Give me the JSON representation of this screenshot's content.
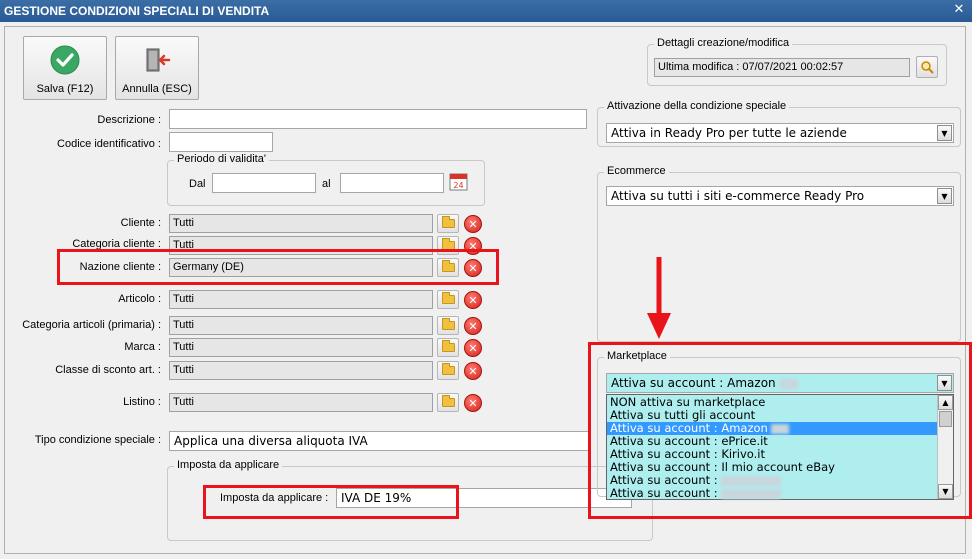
{
  "window": {
    "title": "GESTIONE CONDIZIONI SPECIALI DI VENDITA",
    "close_glyph": "✕"
  },
  "toolbar": {
    "save_label": "Salva (F12)",
    "cancel_label": "Annulla (ESC)"
  },
  "form": {
    "descrizione_label": "Descrizione :",
    "descrizione_value": "",
    "codice_label": "Codice identificativo :",
    "codice_value": "",
    "periodo_title": "Periodo di validita'",
    "dal_label": "Dal",
    "dal_value": "",
    "al_label": "al",
    "al_value": "",
    "calendar_day": "24",
    "cliente_label": "Cliente :",
    "cliente_value": "Tutti",
    "categoria_cliente_label": "Categoria cliente :",
    "categoria_cliente_value": "Tutti",
    "nazione_label": "Nazione cliente :",
    "nazione_value": "Germany (DE)",
    "articolo_label": "Articolo :",
    "articolo_value": "Tutti",
    "categoria_articoli_label": "Categoria articoli (primaria) :",
    "categoria_articoli_value": "Tutti",
    "marca_label": "Marca :",
    "marca_value": "Tutti",
    "classe_label": "Classe di sconto art. :",
    "classe_value": "Tutti",
    "listino_label": "Listino :",
    "listino_value": "Tutti",
    "tipo_label": "Tipo condizione speciale :",
    "tipo_value": "Applica una diversa aliquota IVA",
    "imposta_group_title": "Imposta da applicare",
    "imposta_label": "Imposta da applicare :",
    "imposta_value": "IVA DE 19%"
  },
  "right": {
    "dettagli_title": "Dettagli creazione/modifica",
    "ultima_modifica": "Ultima modifica : 07/07/2021  00:02:57",
    "attivazione_title": "Attivazione della condizione speciale",
    "attivazione_value": "Attiva in Ready Pro per tutte le aziende",
    "ecommerce_title": "Ecommerce",
    "ecommerce_value": "Attiva su tutti i siti e-commerce Ready Pro",
    "marketplace_title": "Marketplace",
    "marketplace_value": "Attiva su account : Amazon",
    "marketplace_options": [
      "NON attiva su marketplace",
      "Attiva su tutti gli account",
      "Attiva su account : Amazon",
      "Attiva su account : ePrice.it",
      "Attiva su account : Kirivo.it",
      "Attiva su account : Il mio account eBay",
      "Attiva su account :",
      "Attiva su account :"
    ]
  },
  "icons": {
    "save": "checkmark-circle-icon",
    "cancel": "exit-door-icon",
    "search": "magnifier-icon",
    "calendar": "calendar-icon",
    "folder": "folder-icon",
    "delete": "delete-x-icon"
  },
  "colors": {
    "title_bar": "#2f6299",
    "highlight_red": "#e8141a",
    "dropdown_bg": "#aeeeef",
    "selected_item": "#3399ff"
  }
}
